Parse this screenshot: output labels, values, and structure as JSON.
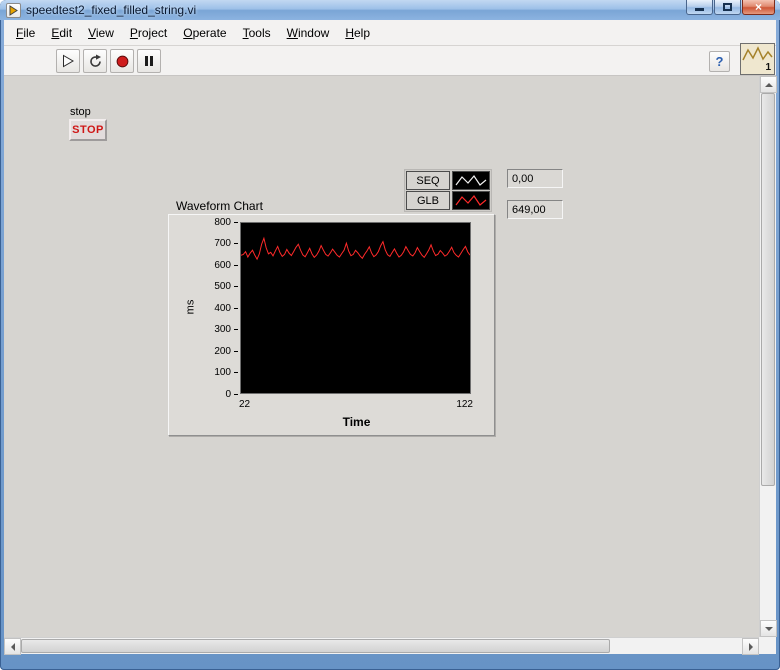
{
  "window": {
    "title": "speedtest2_fixed_filled_string.vi",
    "close_glyph": "×"
  },
  "menu": {
    "items": [
      {
        "label": "File"
      },
      {
        "label": "Edit"
      },
      {
        "label": "View"
      },
      {
        "label": "Project"
      },
      {
        "label": "Operate"
      },
      {
        "label": "Tools"
      },
      {
        "label": "Window"
      },
      {
        "label": "Help"
      }
    ]
  },
  "toolbar": {
    "help_label": "?",
    "vi_icon_label": "1"
  },
  "panel": {
    "stop_label": "stop",
    "stop_button_label": "STOP",
    "legend": {
      "items": [
        {
          "name": "SEQ",
          "color": "#f2f2f2"
        },
        {
          "name": "GLB",
          "color": "#ff2a2a"
        }
      ]
    },
    "indicators": {
      "seq_value": "0,00",
      "glb_value": "649,00"
    }
  },
  "chart_data": {
    "type": "line",
    "title": "Waveform Chart",
    "xlabel": "Time",
    "ylabel": "ms",
    "xlim": [
      22,
      122
    ],
    "ylim": [
      0,
      800
    ],
    "yticks": [
      800,
      700,
      600,
      500,
      400,
      300,
      200,
      100,
      0
    ],
    "xticks": [
      22,
      122
    ],
    "plot_background": "#000000",
    "legend_position": "top-right",
    "grid": false,
    "series": [
      {
        "name": "GLB",
        "color": "#ff2a2a",
        "values": [
          648,
          652,
          665,
          640,
          658,
          672,
          649,
          630,
          655,
          700,
          728,
          683,
          655,
          662,
          645,
          668,
          690,
          661,
          643,
          652,
          676,
          658,
          647,
          665,
          685,
          700,
          672,
          650,
          641,
          660,
          681,
          655,
          638,
          649,
          667,
          694,
          671,
          652,
          644,
          659,
          677,
          663,
          648,
          640,
          656,
          672,
          705,
          668,
          646,
          652,
          671,
          660,
          645,
          634,
          653,
          669,
          688,
          659,
          642,
          650,
          666,
          693,
          712,
          674,
          651,
          643,
          661,
          678,
          657,
          640,
          648,
          664,
          689,
          670,
          652,
          645,
          660,
          684,
          666,
          649,
          638,
          655,
          673,
          697,
          668,
          647,
          653,
          670,
          659,
          644,
          651,
          667,
          686,
          661,
          648,
          640,
          657,
          675,
          690,
          664,
          649
        ]
      }
    ]
  }
}
